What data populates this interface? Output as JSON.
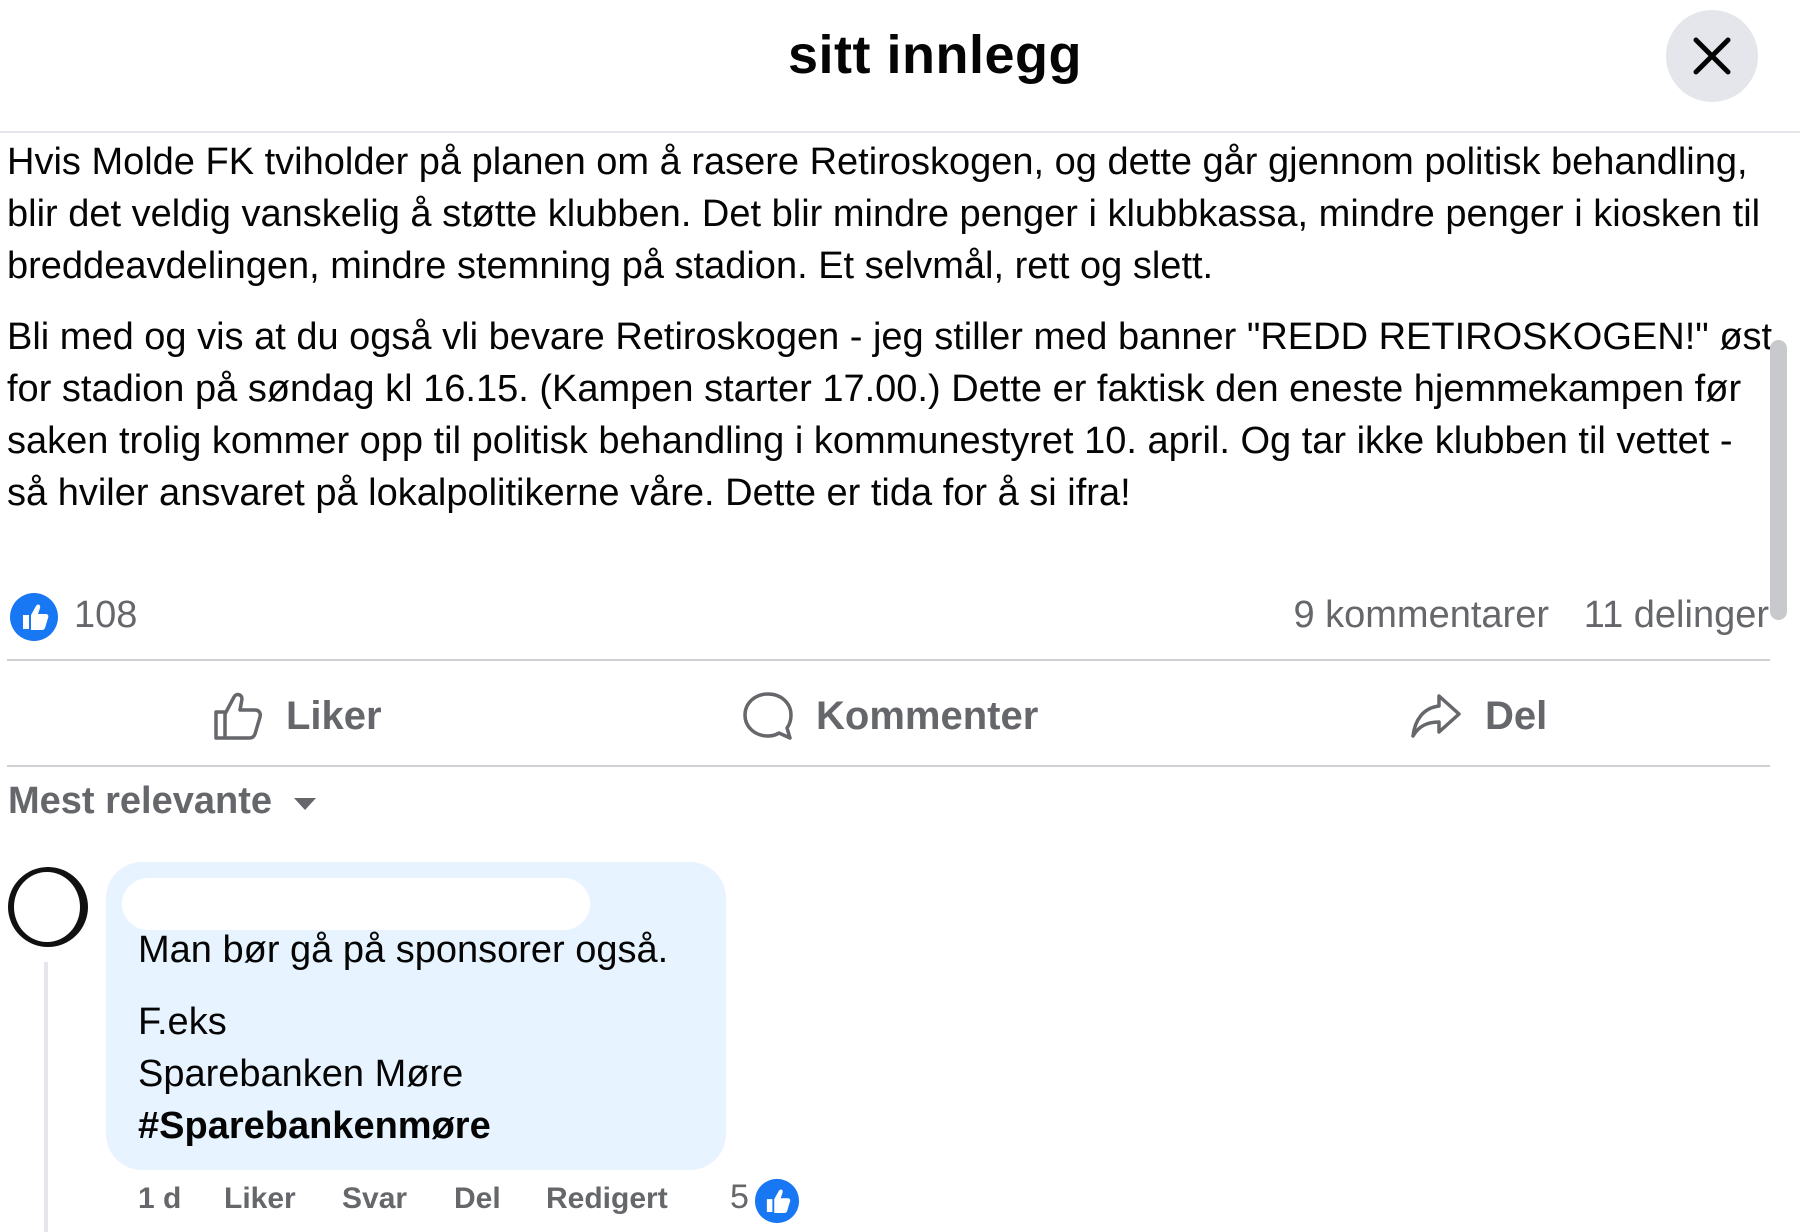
{
  "header": {
    "title": "sitt innlegg",
    "close_icon": "close-icon"
  },
  "post": {
    "paragraph1": "Hvis Molde FK tviholder på planen om å rasere Retiroskogen, og dette går gjennom politisk behandling, blir det veldig vanskelig å støtte klubben. Det blir mindre penger i klubbkassa, mindre penger i kiosken til breddeavdelingen, mindre stemning på stadion. Et selvmål, rett og slett.",
    "paragraph2": "Bli med og vis at du også vli bevare Retiroskogen - jeg stiller med banner \"REDD RETIROSKOGEN!\" øst for stadion på søndag kl 16.15. (Kampen starter 17.00.) Dette er faktisk den eneste hjemmekampen før saken trolig kommer opp til politisk behandling i kommunestyret 10. april. Og tar ikke klubben til vettet - så hviler ansvaret på lokalpolitikerne våre. Dette er tida for å si ifra!"
  },
  "stats": {
    "likes": "108",
    "comments": "9 kommentarer",
    "shares": "11 delinger"
  },
  "actions": {
    "like": "Liker",
    "comment": "Kommenter",
    "share": "Del"
  },
  "comments_sort": {
    "label": "Mest relevante"
  },
  "comment": {
    "lines": [
      "Man bør gå på sponsorer også.",
      "F.eks",
      "Sparebanken Møre",
      "#Sparebankenmøre"
    ],
    "time": "1 d",
    "like": "Liker",
    "reply": "Svar",
    "share": "Del",
    "edited": "Redigert",
    "reactions": "5"
  },
  "colors": {
    "accent": "#1877f2",
    "bubble": "#e7f3ff",
    "muted": "#65676b"
  }
}
